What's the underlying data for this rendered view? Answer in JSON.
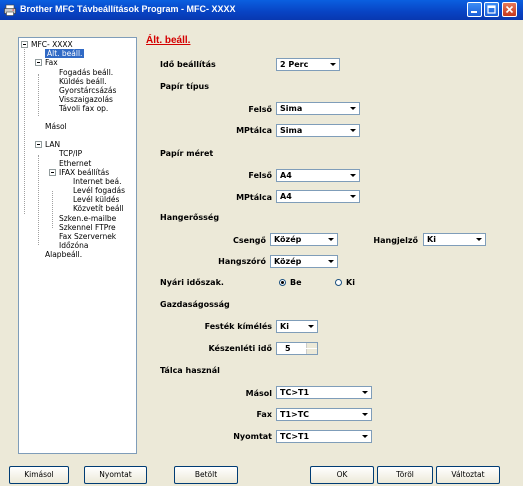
{
  "window": {
    "title": "Brother MFC Távbeállítások Program - MFC- XXXX"
  },
  "tree": {
    "items": [
      {
        "label": "MFC- XXXX"
      },
      {
        "label": "Ált. beáll."
      },
      {
        "label": "Fax"
      },
      {
        "label": "Fogadás beáll."
      },
      {
        "label": "Küldés beáll."
      },
      {
        "label": "Gyorstárcsázás"
      },
      {
        "label": "Visszaigazolás"
      },
      {
        "label": "Távoli fax op."
      },
      {
        "label": "Másol"
      },
      {
        "label": "LAN"
      },
      {
        "label": "TCP/IP"
      },
      {
        "label": "Ethernet"
      },
      {
        "label": "IFAX beállítás"
      },
      {
        "label": "Internet beá."
      },
      {
        "label": "Levél fogadás"
      },
      {
        "label": "Levél küldés"
      },
      {
        "label": "Közvetít beáll"
      },
      {
        "label": "Szken.e-mailbe"
      },
      {
        "label": "Szkennel FTPre"
      },
      {
        "label": "Fax Szervernek"
      },
      {
        "label": "Időzóna"
      },
      {
        "label": "Alapbeáll."
      }
    ]
  },
  "panel": {
    "title": "Ált. beáll.",
    "ido_label": "Idő beállítás",
    "ido_value": "2 Perc",
    "papir_tipus": "Papír típus",
    "felso_label": "Felső",
    "felso_tipus_value": "Sima",
    "mptalca_label": "MPtálca",
    "mptalca_tipus_value": "Sima",
    "papir_meret": "Papír méret",
    "felso_meret_value": "A4",
    "mptalca_meret_value": "A4",
    "hangerosseg": "Hangerősség",
    "csengo_label": "Csengő",
    "csengo_value": "Közép",
    "hangjelzo_label": "Hangjelző",
    "hangjelzo_value": "Ki",
    "hangszoro_label": "Hangszóró",
    "hangszoro_value": "Közép",
    "nyari_label": "Nyári időszak.",
    "nyari_be": "Be",
    "nyari_ki": "Ki",
    "nyari_selected": "Be",
    "gazdasagossag": "Gazdaságosság",
    "festek_label": "Festék kímélés",
    "festek_value": "Ki",
    "keszenleti_label": "Készenléti idő",
    "keszenleti_value": "5",
    "talca_hasznal": "Tálca használ",
    "masol_label": "Másol",
    "masol_value": "TC>T1",
    "fax_label": "Fax",
    "fax_value": "T1>TC",
    "nyomtat_label": "Nyomtat",
    "nyomtat_value": "TC>T1"
  },
  "buttons": {
    "kimasol": "Kimásol",
    "nyomtat": "Nyomtat",
    "betolt": "Betölt",
    "ok": "OK",
    "torol": "Töröl",
    "valtoztat": "Változtat"
  },
  "colors": {
    "titlebar": "#0843c3",
    "panel_title": "#d40000",
    "selection": "#316ac5"
  }
}
